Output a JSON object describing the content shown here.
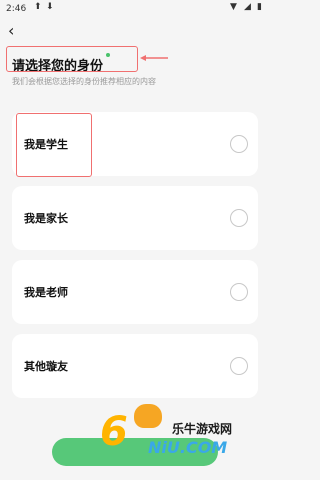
{
  "status_bar": {
    "time": "2:46",
    "icons": [
      "upload-icon",
      "download-icon",
      "wifi-icon",
      "battery-icon"
    ]
  },
  "header": {
    "back_icon": "chevron-left-icon"
  },
  "page": {
    "title": "请选择您的身份",
    "subtitle": "我们会根据您选择的身份推荐相应的内容"
  },
  "options": [
    {
      "label": "我是学生",
      "selected": false
    },
    {
      "label": "我是家长",
      "selected": false
    },
    {
      "label": "我是老师",
      "selected": false
    },
    {
      "label": "其他璇友",
      "selected": false
    }
  ],
  "annotation_color": "#f07070",
  "accent_color": "#57c879",
  "watermark": {
    "text": "乐牛游戏网",
    "logo_text": "6",
    "domain_text": "NiU.COM"
  }
}
